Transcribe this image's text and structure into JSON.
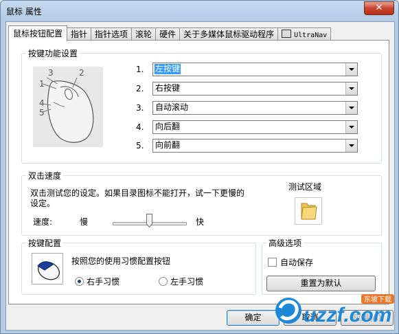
{
  "window": {
    "title": "鼠标 属性",
    "close_glyph": "✕"
  },
  "tabs": [
    {
      "label": "鼠标按钮配置",
      "active": true
    },
    {
      "label": "指针",
      "active": false
    },
    {
      "label": "指针选项",
      "active": false
    },
    {
      "label": "滚轮",
      "active": false
    },
    {
      "label": "硬件",
      "active": false
    },
    {
      "label": "关于多媒体鼠标驱动程序",
      "active": false
    },
    {
      "label": "UltraNav",
      "active": false,
      "icon": "touchpad-icon"
    }
  ],
  "button_functions": {
    "legend": "按键功能设置",
    "diagram_labels": [
      "1",
      "2",
      "3",
      "4",
      "5"
    ],
    "rows": [
      {
        "number": "1.",
        "value": "左按键",
        "selected": true
      },
      {
        "number": "2.",
        "value": "右按键"
      },
      {
        "number": "3.",
        "value": "自动滚动"
      },
      {
        "number": "4.",
        "value": "向后翻"
      },
      {
        "number": "5.",
        "value": "向前翻"
      }
    ]
  },
  "double_click": {
    "legend": "双击速度",
    "description_line1": "双击测试您的设定。如果目录图标不能打开，试一下更慢的",
    "description_line2": "设定。",
    "test_area_label": "测试区域",
    "speed_label": "速度:",
    "slow_label": "慢",
    "fast_label": "快",
    "slider_fraction": 0.5
  },
  "button_config": {
    "legend": "按键配置",
    "description": "按照您的使用习惯配置按钮",
    "right_hand": "右手习惯",
    "left_hand": "左手习惯",
    "selected": "right"
  },
  "advanced": {
    "legend": "高级选项",
    "autosave_label": "自动保存",
    "autosave_checked": false,
    "reset_label": "重置为默认"
  },
  "footer": {
    "ok_label": "确定",
    "cancel_label": "取消",
    "apply_label": "应用(A)"
  },
  "watermark": {
    "top": "东坡下载",
    "brand": "uzzf.com"
  },
  "colors": {
    "selection": "#3399ff",
    "title_gradient": "#b4cbe5",
    "close_red": "#c8442e"
  }
}
